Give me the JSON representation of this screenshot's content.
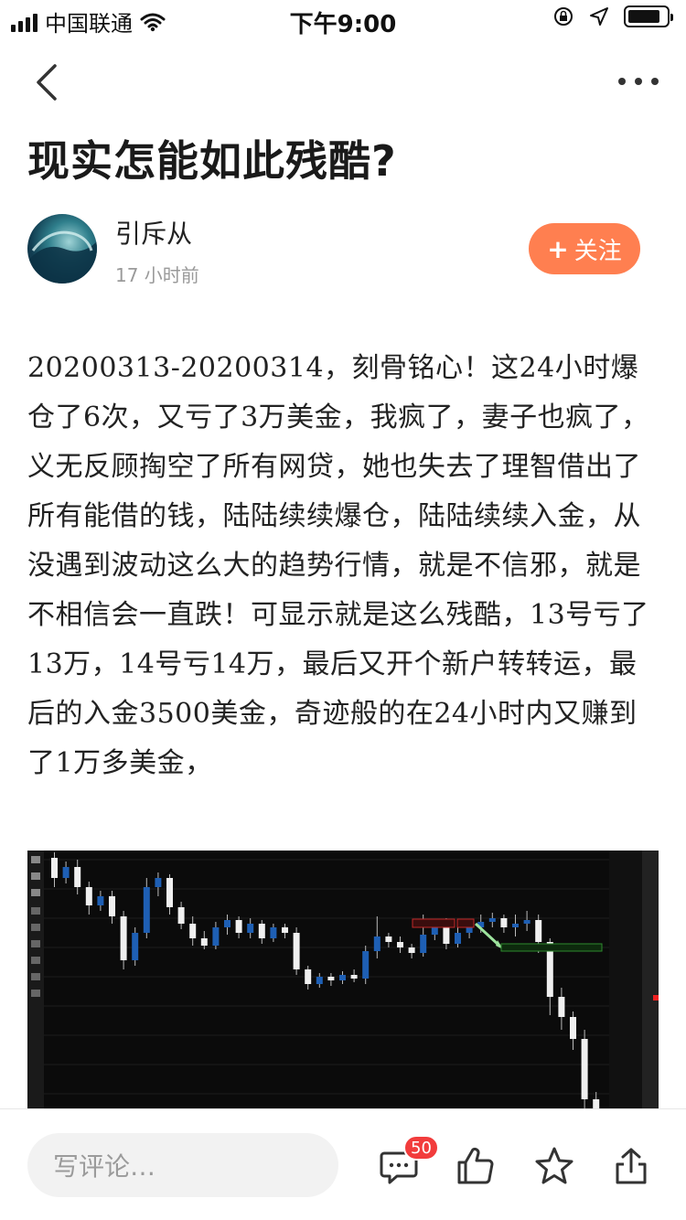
{
  "status_bar": {
    "carrier": "中国联通",
    "time": "下午9:00"
  },
  "article": {
    "title": "现实怎能如此残酷?",
    "author": "引斥从",
    "post_time": "17 小时前",
    "follow_label": "关注",
    "follow_plus": "+",
    "body": "20200313-20200314，刻骨铭心！这24小时爆仓了6次，又亏了3万美金，我疯了，妻子也疯了，义无反顾掏空了所有网贷，她也失去了理智借出了所有能借的钱，陆陆续续爆仓，陆陆续续入金，从没遇到波动这么大的趋势行情，就是不信邪，就是不相信会一直跌！可显示就是这么残酷，13号亏了13万，14号亏14万，最后又开个新户转转运，最后的入金3500美金，奇迹般的在24小时内又赚到了1万多美金，"
  },
  "bottom_bar": {
    "comment_placeholder": "写评论…",
    "comment_count": "50"
  },
  "icons": {
    "back": "chevron-left-icon",
    "more": "more-dots-icon",
    "comment": "comment-icon",
    "like": "thumbs-up-icon",
    "favorite": "star-icon",
    "share": "share-icon"
  },
  "colors": {
    "accent": "#ff7f50",
    "badge": "#f23c3c",
    "chart_bg": "#0b0b0b",
    "candle_up": "#1e5fb4",
    "candle_down": "#f0f0f0"
  }
}
